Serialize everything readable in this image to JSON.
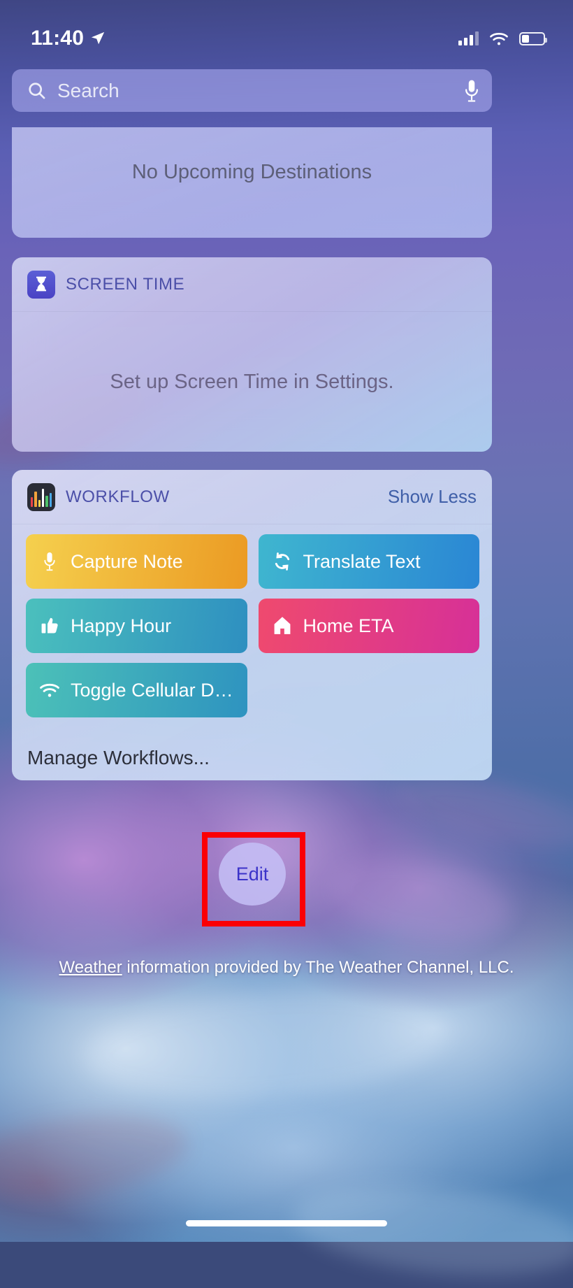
{
  "status_bar": {
    "time": "11:40",
    "location_icon": "location-arrow-icon",
    "signal_icon": "cellular-signal-icon",
    "wifi_icon": "wifi-icon",
    "battery_icon": "battery-icon"
  },
  "search": {
    "placeholder": "Search",
    "icon": "search-icon",
    "mic_icon": "microphone-icon"
  },
  "widgets": [
    {
      "id": "maps",
      "empty_message": "No Upcoming Destinations"
    },
    {
      "id": "screentime",
      "title": "SCREEN TIME",
      "icon": "hourglass-icon",
      "message": "Set up Screen Time in Settings."
    },
    {
      "id": "workflow",
      "title": "WORKFLOW",
      "icon": "workflow-app-icon",
      "action_label": "Show Less",
      "actions": [
        {
          "label": "Capture Note",
          "icon": "microphone-icon",
          "color_start": "#f5d04e",
          "color_end": "#eb9a23"
        },
        {
          "label": "Translate Text",
          "icon": "refresh-icon",
          "color_start": "#3fb6cf",
          "color_end": "#2a86d4"
        },
        {
          "label": "Happy Hour",
          "icon": "thumbs-up-icon",
          "color_start": "#4bc0bd",
          "color_end": "#2e8fc0"
        },
        {
          "label": "Home ETA",
          "icon": "home-icon",
          "color_start": "#ef4a6e",
          "color_end": "#d63098"
        },
        {
          "label": "Toggle Cellular D…",
          "icon": "wifi-icon",
          "color_start": "#4cc1b8",
          "color_end": "#2e93c0"
        }
      ],
      "manage_label": "Manage Workflows..."
    }
  ],
  "edit_button": {
    "label": "Edit",
    "highlight_color": "#fb0005"
  },
  "attribution": {
    "link_text": "Weather",
    "rest_text": " information provided by The Weather Channel, LLC."
  }
}
